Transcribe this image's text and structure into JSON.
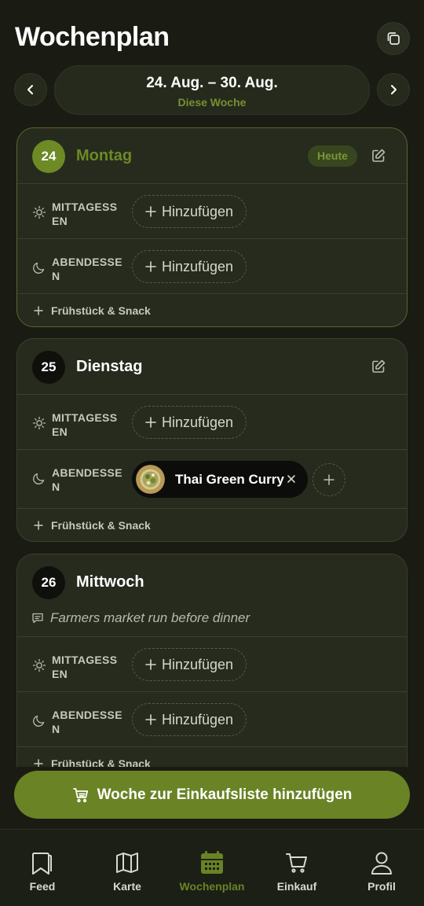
{
  "header": {
    "title": "Wochenplan"
  },
  "week": {
    "range": "24. Aug. – 30. Aug.",
    "subtitle": "Diese Woche"
  },
  "colors": {
    "accent": "#6a8325",
    "background": "#1a1c14",
    "card": "#262b1d"
  },
  "days": [
    {
      "number": "24",
      "name": "Montag",
      "badge": "Heute",
      "meals": [
        {
          "label": "MITTAGESSEN",
          "add_label": "Hinzufügen",
          "icon": "sun-icon"
        },
        {
          "label": "ABENDESSEN",
          "add_label": "Hinzufügen",
          "icon": "moon-icon"
        }
      ],
      "snack_label": "Frühstück & Snack"
    },
    {
      "number": "25",
      "name": "Dienstag",
      "meals": [
        {
          "label": "MITTAGESSEN",
          "add_label": "Hinzufügen",
          "icon": "sun-icon"
        },
        {
          "label": "ABENDESSEN",
          "recipe": "Thai Green Curry",
          "icon": "moon-icon"
        }
      ],
      "snack_label": "Frühstück & Snack"
    },
    {
      "number": "26",
      "name": "Mittwoch",
      "note": "Farmers market run before dinner",
      "meals": [
        {
          "label": "MITTAGESSEN",
          "add_label": "Hinzufügen",
          "icon": "sun-icon"
        },
        {
          "label": "ABENDESSEN",
          "add_label": "Hinzufügen",
          "icon": "moon-icon"
        }
      ],
      "snack_label": "Frühstück & Snack"
    }
  ],
  "cta": {
    "label": "Woche zur Einkaufsliste hinzufügen"
  },
  "bottom_nav": [
    {
      "label": "Feed",
      "icon": "bookmark-icon"
    },
    {
      "label": "Karte",
      "icon": "map-icon"
    },
    {
      "label": "Wochenplan",
      "icon": "calendar-icon",
      "active": true
    },
    {
      "label": "Einkauf",
      "icon": "cart-icon"
    },
    {
      "label": "Profil",
      "icon": "user-icon"
    }
  ]
}
